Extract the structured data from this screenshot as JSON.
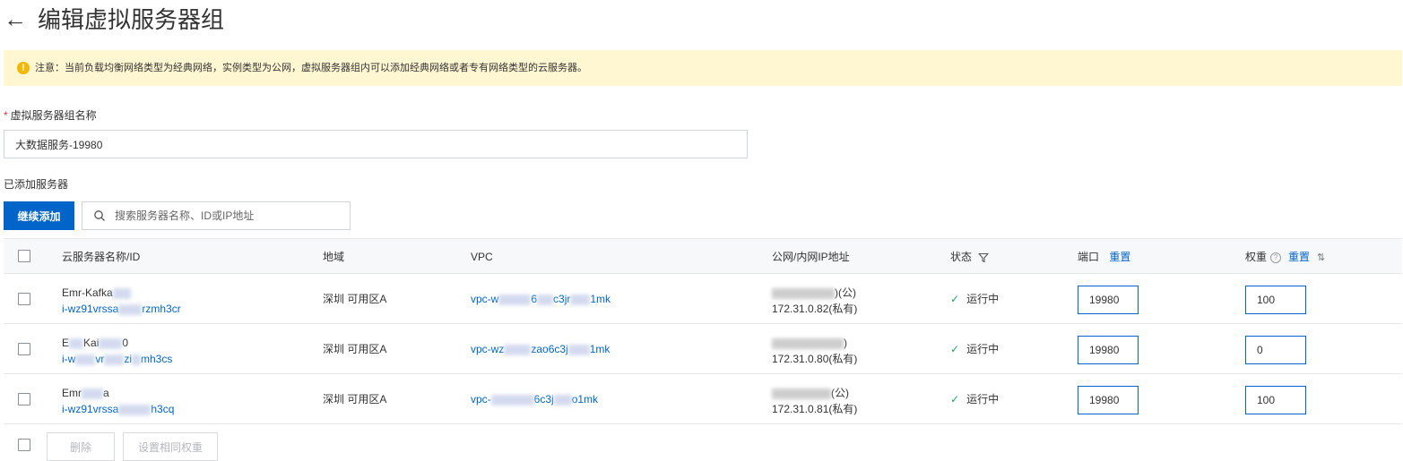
{
  "header": {
    "title": "编辑虚拟服务器组"
  },
  "notice": {
    "text": "注意：当前负载均衡网络类型为经典网络，实例类型为公网，虚拟服务器组内可以添加经典网络或者专有网络类型的云服务器。"
  },
  "form": {
    "name_label": "虚拟服务器组名称",
    "required_mark": "*",
    "name_value": "大数据服务-19980"
  },
  "servers": {
    "section_label": "已添加服务器",
    "add_button": "继续添加",
    "search_placeholder": "搜索服务器名称、ID或IP地址"
  },
  "table": {
    "columns": {
      "name": "云服务器名称/ID",
      "region": "地域",
      "vpc": "VPC",
      "ip": "公网/内网IP地址",
      "status": "状态",
      "port": "端口",
      "weight": "权重",
      "reset": "重置"
    },
    "rows": [
      {
        "name": "Emr-Kafka",
        "id_prefix": "i-wz91vrssa",
        "id_suffix": "rzmh3cr",
        "region": "深圳 可用区A",
        "vpc_prefix": "vpc-w",
        "vpc_mid": "6",
        "vpc_suffix": "c3jr",
        "vpc_end": "1mk",
        "public_ip_suffix": ")(公)",
        "private_ip": "172.31.0.82(私有)",
        "status": "运行中",
        "port": "19980",
        "weight": "100"
      },
      {
        "name_prefix": "E",
        "name": "Kai",
        "name_suffix": "0",
        "id_prefix": "i-w",
        "id_mid": "vr",
        "id_mid2": "zi",
        "id_suffix": "mh3cs",
        "region": "深圳 可用区A",
        "vpc_prefix": "vpc-wz",
        "vpc_mid": "zao6c3j",
        "vpc_end": "1mk",
        "public_ip_suffix": ")",
        "private_ip": "172.31.0.80(私有)",
        "status": "运行中",
        "port": "19980",
        "weight": "0"
      },
      {
        "name": "Emr",
        "name_suffix": "a",
        "id_prefix": "i-wz91vrssa",
        "id_suffix": "h3cq",
        "region": "深圳 可用区A",
        "vpc_prefix": "vpc-",
        "vpc_mid": "6c3j",
        "vpc_end": "o1mk",
        "public_ip_suffix": "(公)",
        "private_ip": "172.31.0.81(私有)",
        "status": "运行中",
        "port": "19980",
        "weight": "100"
      }
    ]
  },
  "footer": {
    "delete_button": "删除",
    "set_weight_button": "设置相同权重"
  },
  "colors": {
    "primary": "#0064c8",
    "notice_bg": "#fff7d1",
    "success": "#1ca56b"
  }
}
